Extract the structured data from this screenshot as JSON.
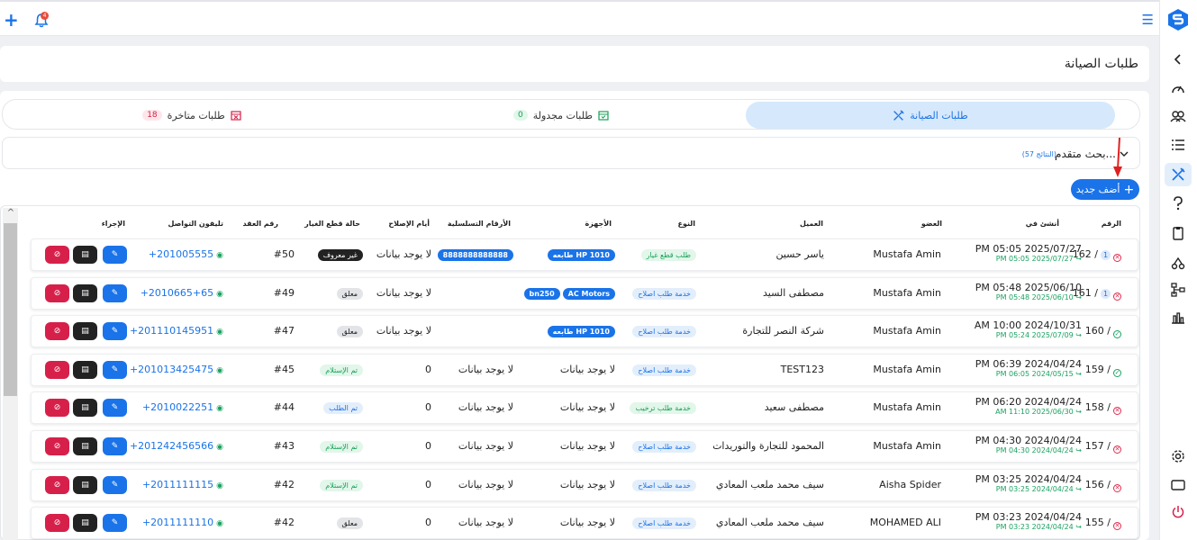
{
  "page": {
    "title": "طلبات الصيانة",
    "notification_count": "4"
  },
  "tabs": [
    {
      "label": "طلبات الصيانة",
      "badge": ""
    },
    {
      "label": "طلبات مجدولة",
      "badge": "0"
    },
    {
      "label": "طلبات متاخرة",
      "badge": "18"
    }
  ],
  "search": {
    "label": "بحث متقدم...",
    "results": "(57 النتائج)"
  },
  "add_button": "أضف جديد",
  "table": {
    "headers": {
      "num": "الرقم",
      "created": "أنشئ في",
      "member": "العضو",
      "client": "العميل",
      "type": "النوع",
      "devices": "الأجهزة",
      "serials": "الأرقام التسلسلية",
      "repair_days": "أيام الإصلاح",
      "spare_status": "حالة قطع الغيار",
      "contract": "رقم العقد",
      "phone": "تليفون التواصل",
      "action": "الإجراء"
    },
    "rows": [
      {
        "num": "162 /",
        "badge": "1",
        "status": "red",
        "date": "PM 05:05 2025/07/27",
        "sub_date": "PM 05:05 2025/07/27 ↪",
        "member": "Mustafa Amin",
        "client": "ياسر حسين",
        "type": "طلب قطع غيار",
        "type_color": "green",
        "devices": [
          "طابعه HP 1010"
        ],
        "serials_badge": "8888888888888",
        "serials": "",
        "repair_days": "لا يوجد بيانات",
        "spare": "غير معروف",
        "spare_color": "dark",
        "contract": "#50",
        "phone": "+201005555"
      },
      {
        "num": "161 /",
        "badge": "1",
        "status": "red",
        "date": "PM 05:48 2025/06/10",
        "sub_date": "PM 05:48 2025/06/10 ↪",
        "member": "Mustafa Amin",
        "client": "مصطفى السيد",
        "type": "خدمة طلب اصلاح",
        "type_color": "blue",
        "devices": [
          "bn250",
          "AC Motors"
        ],
        "serials_badge": "",
        "serials": "",
        "repair_days": "لا يوجد بيانات",
        "spare": "معلق",
        "spare_color": "gray",
        "contract": "#49",
        "phone": "+2010665+65"
      },
      {
        "num": "160 /",
        "badge": "",
        "status": "green",
        "date": "AM 10:00 2024/10/31",
        "sub_date": "PM 05:24 2025/07/09 ↪",
        "member": "Mustafa Amin",
        "client": "شركة النصر للتجارة",
        "type": "خدمة طلب اصلاح",
        "type_color": "blue",
        "devices": [
          "طابعه HP 1010"
        ],
        "serials_badge": "",
        "serials": "",
        "repair_days": "لا يوجد بيانات",
        "spare": "معلق",
        "spare_color": "gray",
        "contract": "#47",
        "phone": "+201110145951"
      },
      {
        "num": "159 /",
        "badge": "",
        "status": "green",
        "date": "PM 06:39 2024/04/24",
        "sub_date": "PM 06:05 2024/05/15 ↪",
        "member": "Mustafa Amin",
        "client": "TEST123",
        "type": "خدمة طلب اصلاح",
        "type_color": "blue",
        "devices_text": "لا يوجد بيانات",
        "serials_badge": "",
        "serials": "لا يوجد بيانات",
        "repair_days": "0",
        "spare": "تم الإستلام",
        "spare_color": "green",
        "contract": "#45",
        "phone": "+201013425475"
      },
      {
        "num": "158 /",
        "badge": "",
        "status": "red",
        "date": "PM 06:20 2024/04/24",
        "sub_date": "AM 11:10 2025/06/30 ↪",
        "member": "Mustafa Amin",
        "client": "مصطفى سعيد",
        "type": "خدمة طلب ترخيب",
        "type_color": "green",
        "devices_text": "لا يوجد بيانات",
        "serials_badge": "",
        "serials": "لا يوجد بيانات",
        "repair_days": "0",
        "spare": "تم الطلب",
        "spare_color": "blue",
        "contract": "#44",
        "phone": "+2010022251"
      },
      {
        "num": "157 /",
        "badge": "",
        "status": "red",
        "date": "PM 04:30 2024/04/24",
        "sub_date": "PM 04:30 2024/04/24 ↪",
        "member": "Mustafa Amin",
        "client": "المحمود للتجارة والتوريدات",
        "type": "خدمة طلب اصلاح",
        "type_color": "blue",
        "devices_text": "لا يوجد بيانات",
        "serials_badge": "",
        "serials": "لا يوجد بيانات",
        "repair_days": "0",
        "spare": "تم الإستلام",
        "spare_color": "green",
        "contract": "#43",
        "phone": "+201242456566"
      },
      {
        "num": "156 /",
        "badge": "",
        "status": "red",
        "date": "PM 03:25 2024/04/24",
        "sub_date": "PM 03:25 2024/04/24 ↪",
        "member": "Aisha Spider",
        "client": "سيف محمد ملعب المعادي",
        "type": "خدمة طلب اصلاح",
        "type_color": "blue",
        "devices_text": "لا يوجد بيانات",
        "serials_badge": "",
        "serials": "لا يوجد بيانات",
        "repair_days": "0",
        "spare": "تم الإستلام",
        "spare_color": "green",
        "contract": "#42",
        "phone": "+2011111115"
      },
      {
        "num": "155 /",
        "badge": "",
        "status": "red",
        "date": "PM 03:23 2024/04/24",
        "sub_date": "PM 03:23 2024/04/24 ↪",
        "member": "MOHAMED ALI",
        "client": "سيف محمد ملعب المعادي",
        "type": "خدمة طلب اصلاح",
        "type_color": "blue",
        "devices_text": "لا يوجد بيانات",
        "serials_badge": "",
        "serials": "لا يوجد بيانات",
        "repair_days": "0",
        "spare": "معلق",
        "spare_color": "gray",
        "contract": "#42",
        "phone": "+2011111110"
      }
    ]
  },
  "sidebar": {
    "items": [
      "chevron-left-icon",
      "dashboard-icon",
      "users-icon",
      "list-icon",
      "tools-icon",
      "help-icon",
      "clipboard-icon",
      "delivery-icon",
      "network-icon",
      "chart-icon",
      "gear-icon",
      "display-icon",
      "power-icon"
    ]
  },
  "colors": {
    "accent": "#1a73e8",
    "danger": "#d6204a",
    "success": "#1aa260"
  }
}
